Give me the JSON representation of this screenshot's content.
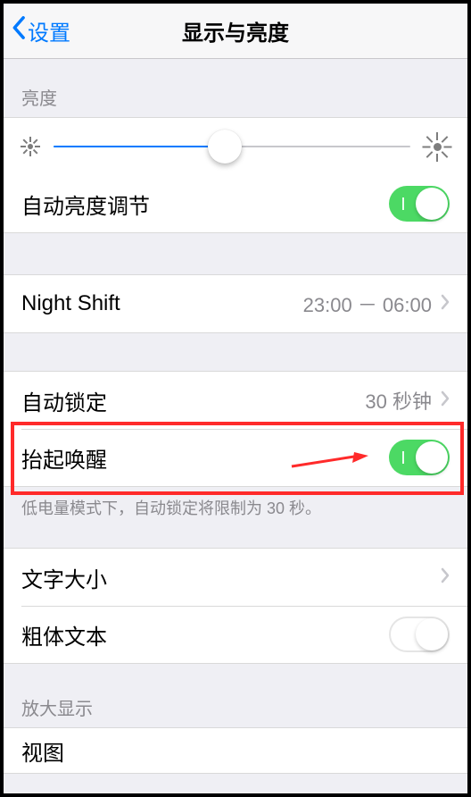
{
  "nav": {
    "back": "设置",
    "title": "显示与亮度"
  },
  "brightness": {
    "header": "亮度",
    "autoLabel": "自动亮度调节",
    "autoOn": true,
    "sliderValue": 48
  },
  "nightShift": {
    "label": "Night Shift",
    "schedule": "23:00 － 06:00"
  },
  "autoLock": {
    "label": "自动锁定",
    "value": "30 秒钟"
  },
  "raiseToWake": {
    "label": "抬起唤醒",
    "on": true
  },
  "lowPowerNote": "低电量模式下，自动锁定将限制为 30 秒。",
  "textSize": {
    "label": "文字大小"
  },
  "boldText": {
    "label": "粗体文本",
    "on": false
  },
  "zoom": {
    "header": "放大显示",
    "viewLabel": "视图"
  }
}
